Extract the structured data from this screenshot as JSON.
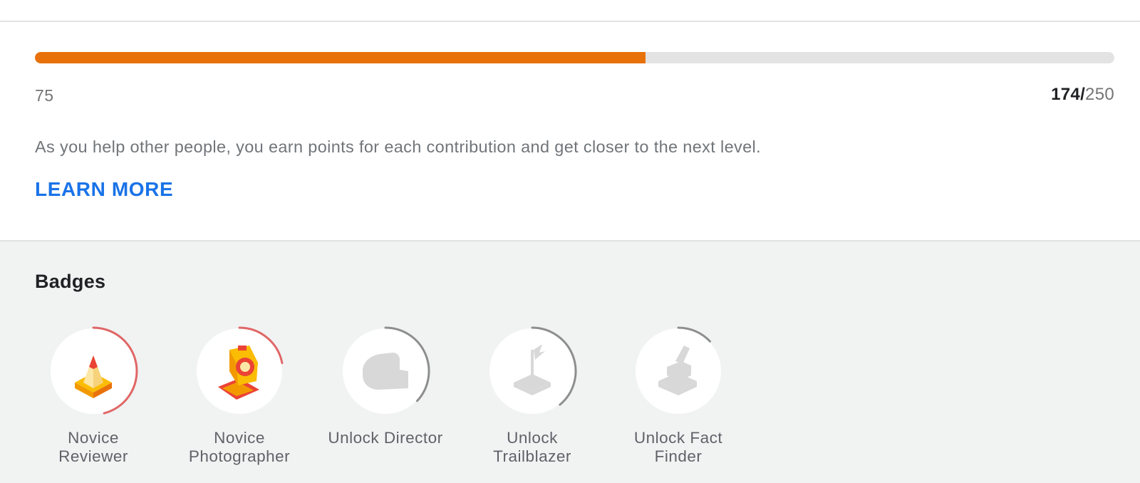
{
  "level": {
    "progress_fraction": 0.5654,
    "start_value": "75",
    "current": "174",
    "separator": "/",
    "total": "250",
    "description": "As you help other people, you earn points for each contribution and get closer to the next level.",
    "learn_more_label": "LEARN MORE"
  },
  "badges": {
    "title": "Badges",
    "items": [
      {
        "line1": "Novice",
        "line2": "Reviewer",
        "icon": "reviewer-pencil-icon",
        "ring_color": "#e06666",
        "progress": 0.46,
        "unlocked": true
      },
      {
        "line1": "Novice",
        "line2": "Photographer",
        "icon": "photographer-camera-icon",
        "ring_color": "#e06666",
        "progress": 0.22,
        "unlocked": true
      },
      {
        "line1": "Unlock Director",
        "line2": "",
        "icon": "director-clapper-icon",
        "ring_color": "#8e8e8e",
        "progress": 0.37,
        "unlocked": false
      },
      {
        "line1": "Unlock",
        "line2": "Trailblazer",
        "icon": "trailblazer-flag-icon",
        "ring_color": "#8e8e8e",
        "progress": 0.39,
        "unlocked": false
      },
      {
        "line1": "Unlock Fact",
        "line2": "Finder",
        "icon": "fact-finder-icon",
        "ring_color": "#8e8e8e",
        "progress": 0.13,
        "unlocked": false
      }
    ]
  },
  "colors": {
    "progress_fill": "#e8710a",
    "progress_track": "#e3e3e3",
    "link": "#1a73e8"
  }
}
